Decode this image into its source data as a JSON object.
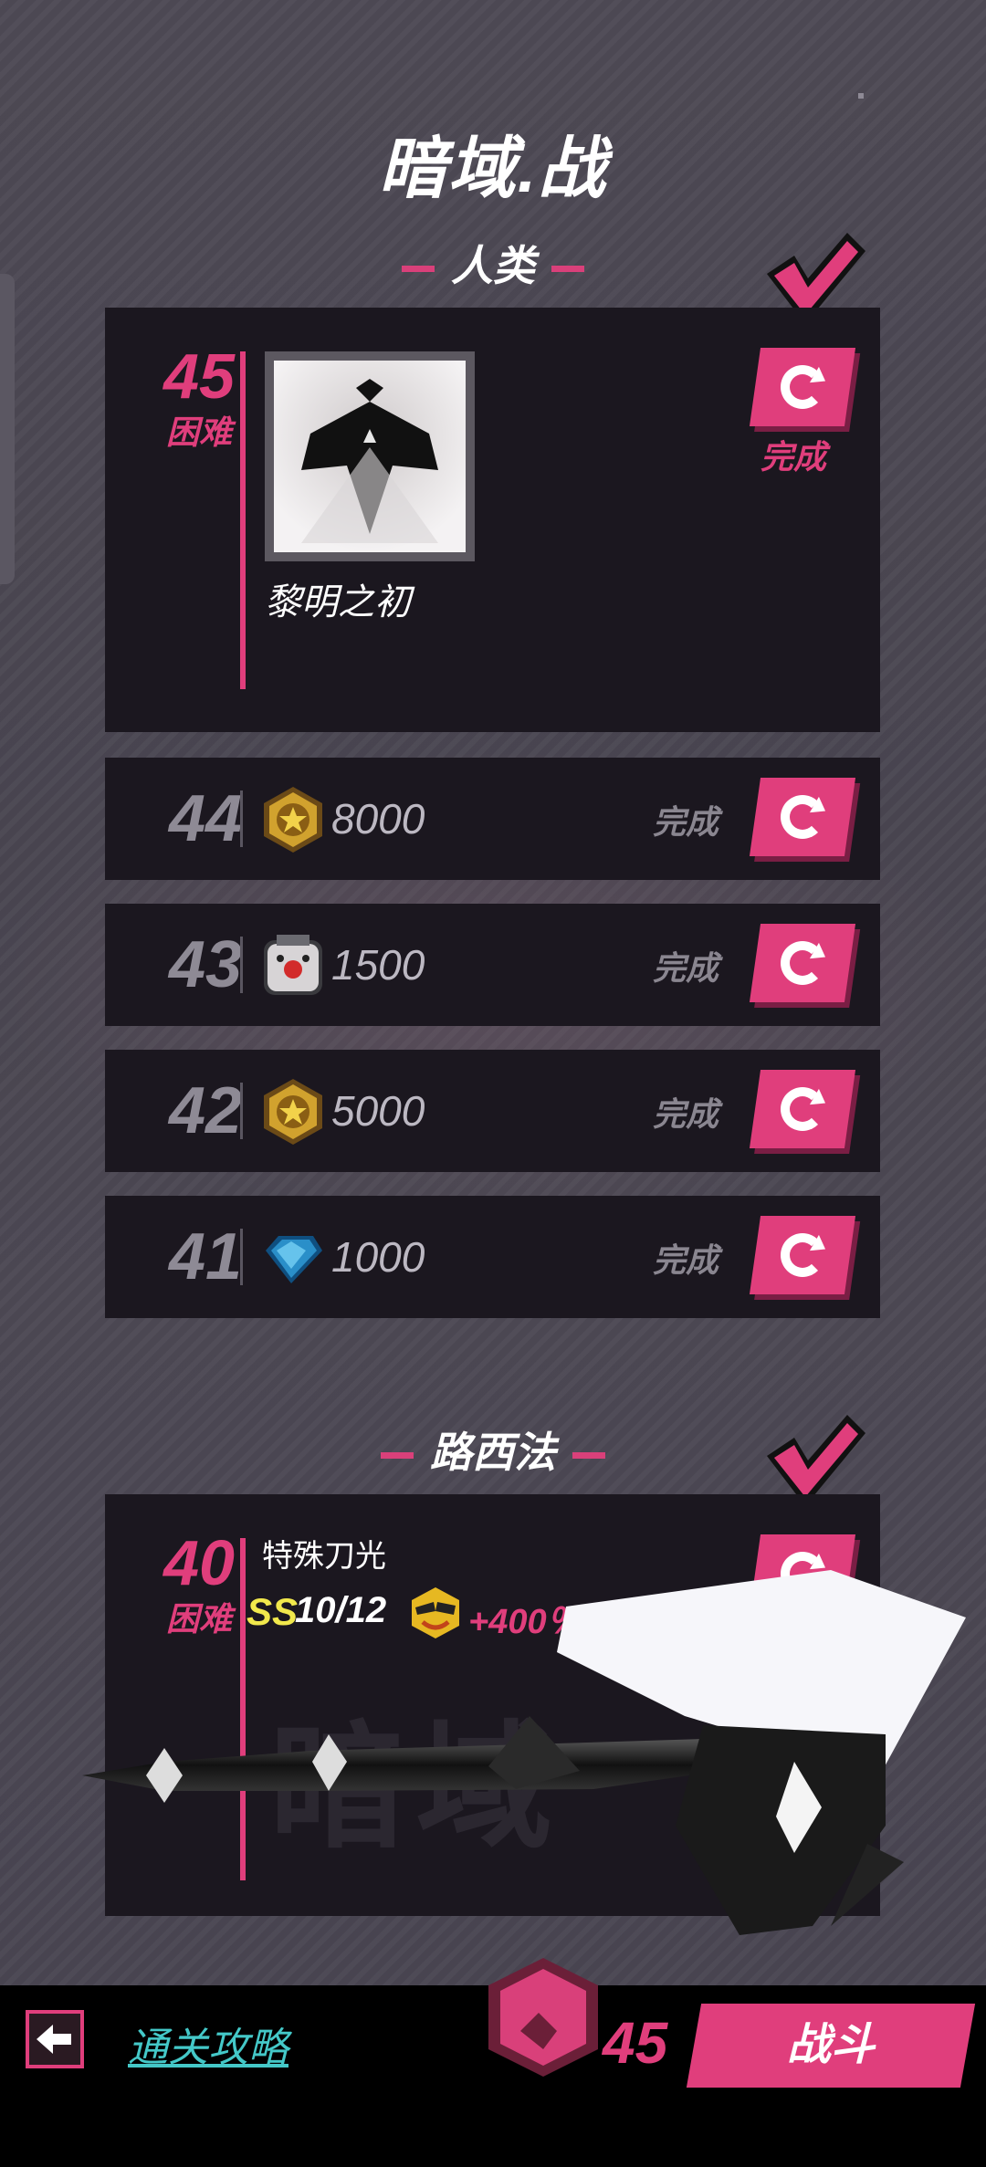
{
  "screen": {
    "title": "暗域.战"
  },
  "sections": [
    {
      "name": "人类",
      "featured": {
        "level": "45",
        "difficulty": "困难",
        "reward_name": "黎明之初",
        "status": "完成"
      },
      "rows": [
        {
          "level": "44",
          "reward_icon": "gold-coin-icon",
          "value": "8000",
          "status": "完成"
        },
        {
          "level": "43",
          "reward_icon": "robot-face-icon",
          "value": "1500",
          "status": "完成"
        },
        {
          "level": "42",
          "reward_icon": "gold-coin-icon",
          "value": "5000",
          "status": "完成"
        },
        {
          "level": "41",
          "reward_icon": "blue-gem-icon",
          "value": "1000",
          "status": "完成"
        }
      ]
    },
    {
      "name": "路西法",
      "featured": {
        "level": "40",
        "difficulty": "困难",
        "reward_name": "特殊刀光",
        "rank": "SS",
        "progress": "10/12",
        "bonus": "+400％",
        "watermark": "暗域"
      }
    }
  ],
  "bottom": {
    "guide": "通关攻略",
    "level": "45",
    "fight": "战斗"
  },
  "colors": {
    "accent": "#e03e7c",
    "panel": "#1b171f",
    "guide": "#44c8c8"
  }
}
